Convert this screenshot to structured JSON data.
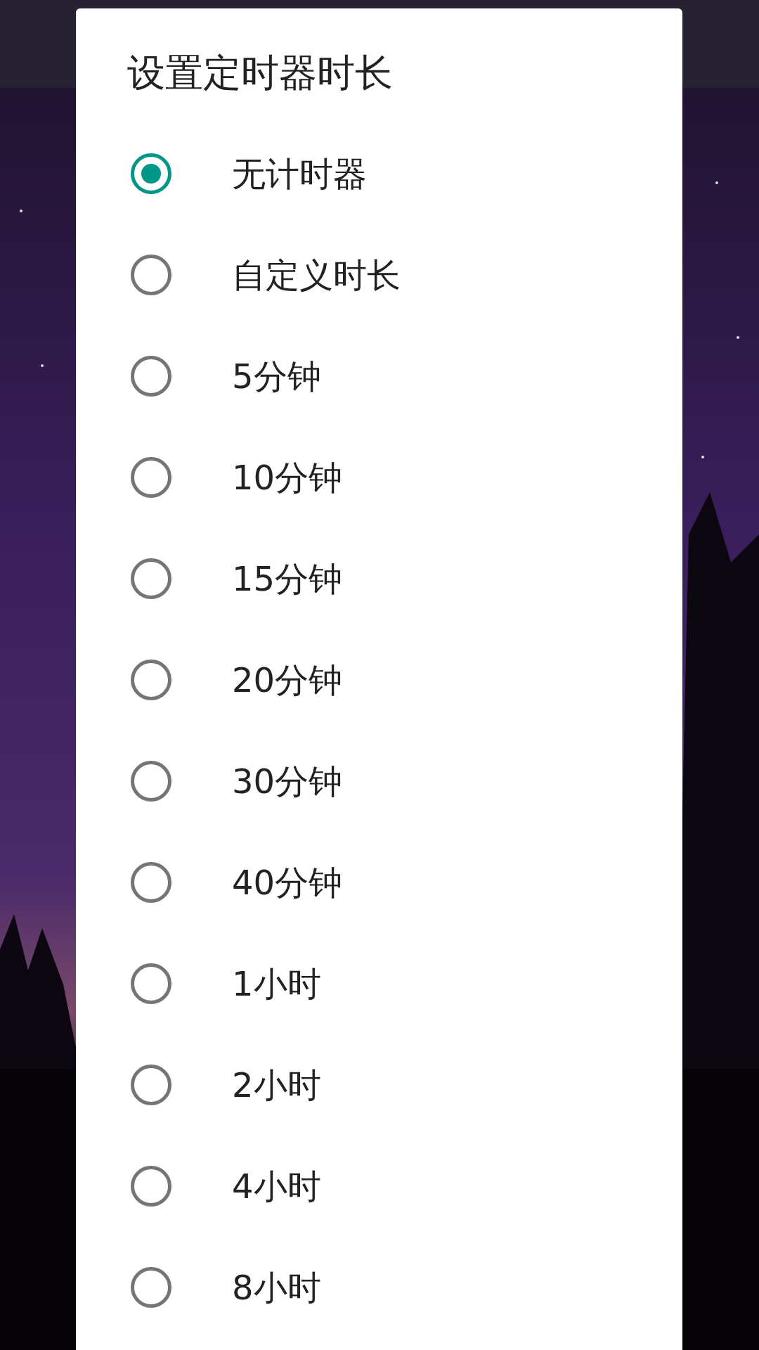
{
  "dialog": {
    "title": "设置定时器时长",
    "options": [
      {
        "label": "无计时器",
        "selected": true
      },
      {
        "label": "自定义时长",
        "selected": false
      },
      {
        "label": "5分钟",
        "selected": false
      },
      {
        "label": "10分钟",
        "selected": false
      },
      {
        "label": "15分钟",
        "selected": false
      },
      {
        "label": "20分钟",
        "selected": false
      },
      {
        "label": "30分钟",
        "selected": false
      },
      {
        "label": "40分钟",
        "selected": false
      },
      {
        "label": "1小时",
        "selected": false
      },
      {
        "label": "2小时",
        "selected": false
      },
      {
        "label": "4小时",
        "selected": false
      },
      {
        "label": "8小时",
        "selected": false
      }
    ]
  }
}
